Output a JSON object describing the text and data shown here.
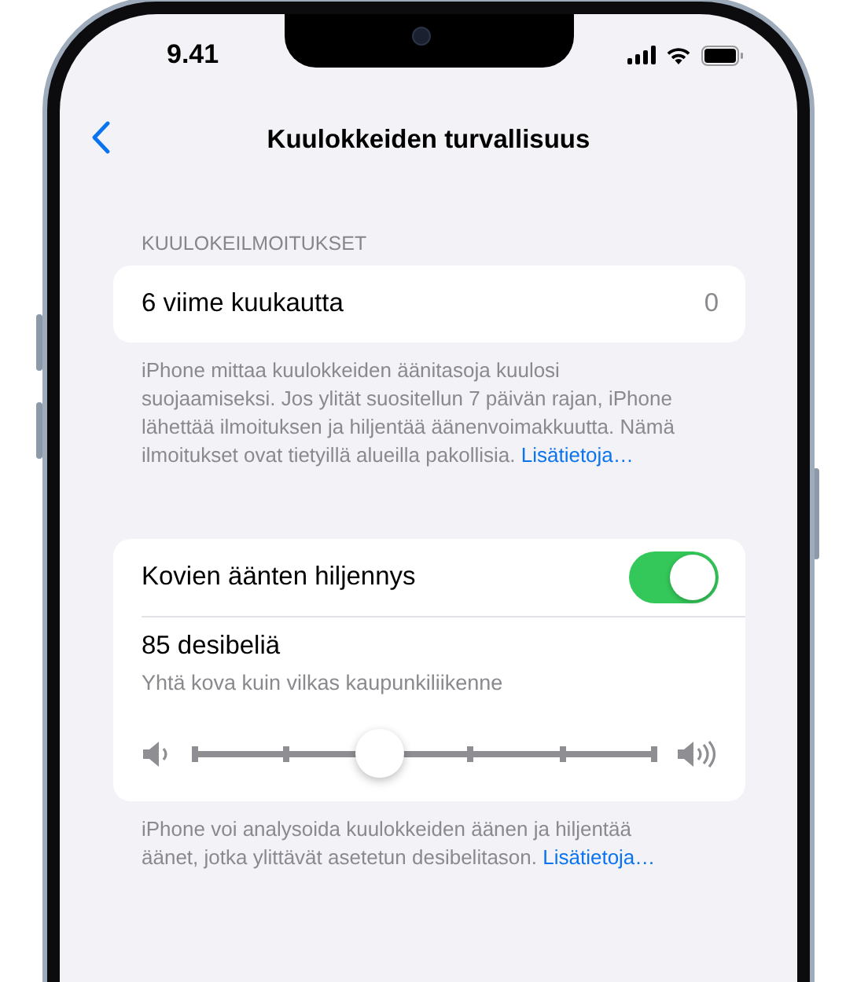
{
  "status_bar": {
    "time": "9.41"
  },
  "nav": {
    "title": "Kuulokkeiden turvallisuus"
  },
  "notifications": {
    "header": "KUULOKEILMOITUKSET",
    "row": {
      "label": "6 viime kuukautta",
      "value": "0"
    },
    "footer": {
      "text": "iPhone mittaa kuulokkeiden äänitasoja kuulosi suojaamiseksi. Jos ylität suositellun 7 päivän rajan, iPhone lähettää ilmoituksen ja hiljentää äänenvoimakkuutta. Nämä ilmoitukset ovat tietyillä alueilla pakollisia.",
      "link": "Lisätietoja…"
    }
  },
  "reduce": {
    "toggle": {
      "label": "Kovien äänten hiljennys",
      "on": true
    },
    "level_title": "85 desibeliä",
    "level_subtitle": "Yhtä kova kuin vilkas kaupunkiliikenne",
    "slider": {
      "level": 0.4
    },
    "footer": {
      "text": "iPhone voi analysoida kuulokkeiden äänen ja hiljentää äänet, jotka ylittävät asetetun desibelitason.",
      "link": "Lisätietoja…"
    }
  }
}
